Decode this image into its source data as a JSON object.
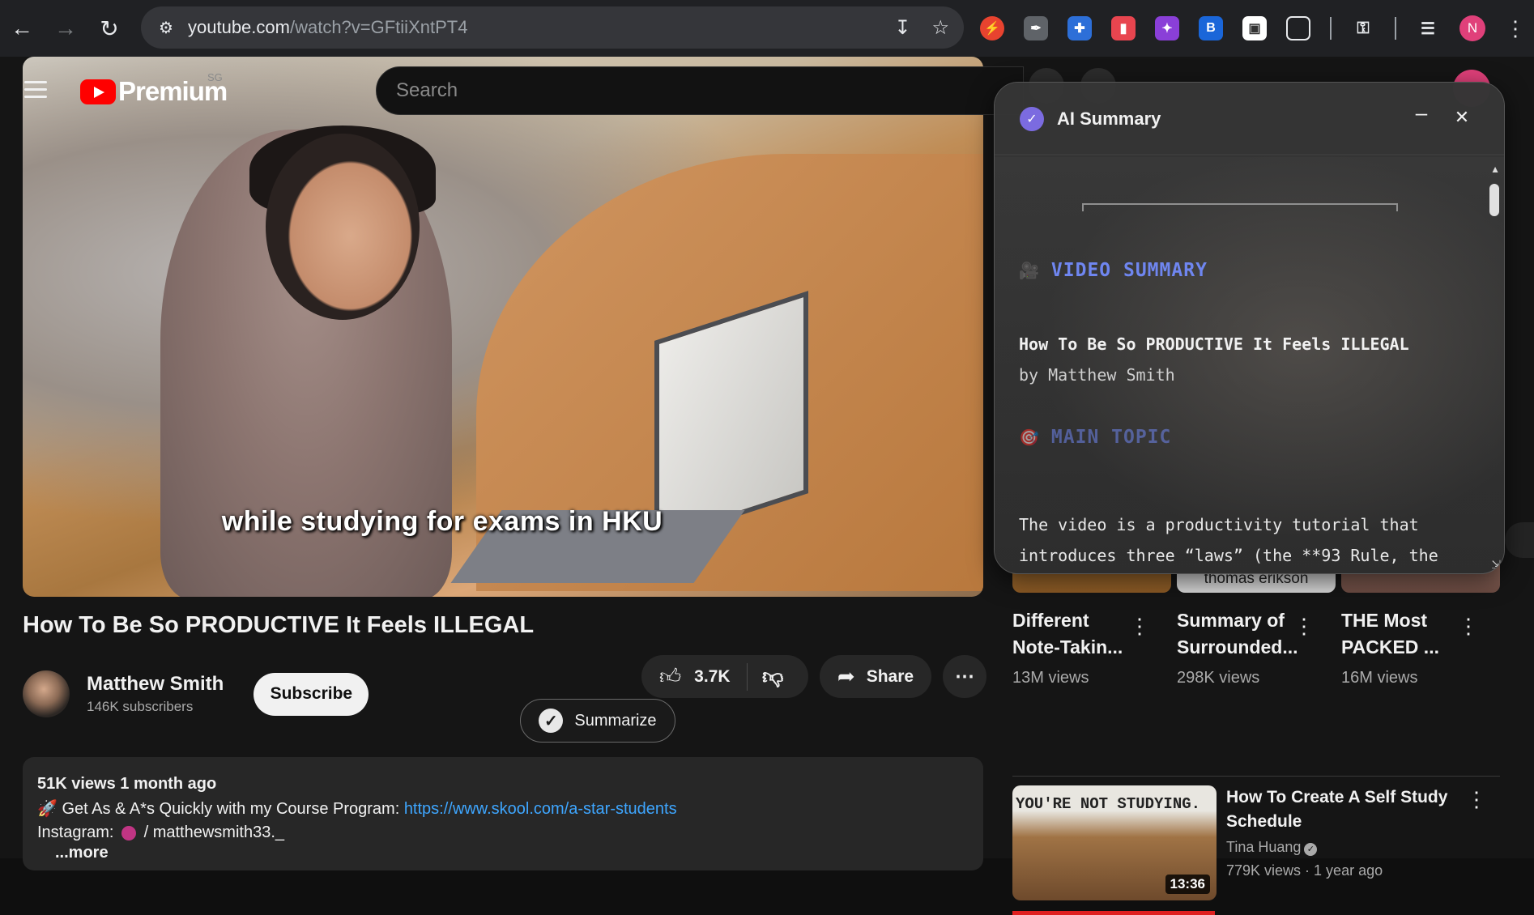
{
  "browser": {
    "url_host": "youtube.com",
    "url_path": "/watch?v=GFtiiXntPT4",
    "profile_initial": "N"
  },
  "youtube": {
    "logo_text": "Premium",
    "country_code": "SG",
    "search_placeholder": "Search"
  },
  "video": {
    "caption": "while studying for exams in HKU",
    "title": "How To Be So PRODUCTIVE It Feels ILLEGAL",
    "channel": "Matthew Smith",
    "subscribers": "146K subscribers",
    "subscribe_label": "Subscribe",
    "likes": "3.7K",
    "share_label": "Share",
    "summarize_label": "Summarize",
    "description": {
      "stats": "51K views  1 month ago",
      "line1_prefix": "🚀 Get As & A*s Quickly with my Course Program: ",
      "line1_link": "https://www.skool.com/a-star-students",
      "line2_prefix": "Instagram: ",
      "line2_handle": " / matthewsmith33._",
      "more": "...more"
    }
  },
  "shorts": [
    {
      "title": "Different Note-Takin...",
      "views": "13M views",
      "thumb_text": ""
    },
    {
      "title": "Summary of Surrounded...",
      "views": "298K views",
      "thumb_text": "thomas erikson"
    },
    {
      "title": "THE Most PACKED ...",
      "views": "16M views",
      "thumb_text": ""
    }
  ],
  "recommendation": {
    "thumb_banner": "YOU'RE NOT STUDYING.",
    "duration": "13:36",
    "title": "How To Create A Self Study Schedule",
    "channel": "Tina Huang",
    "meta": "779K views · 1 year ago"
  },
  "ai_summary": {
    "title": "AI Summary",
    "section_video": "VIDEO SUMMARY",
    "video_title": "How To Be So PRODUCTIVE It Feels ILLEGAL",
    "video_by": "by Matthew Smith",
    "section_topic": "MAIN TOPIC",
    "paragraph": "The video is a productivity tutorial that introduces three “laws” (the **93 Rule, the",
    "emoji_video": "🎥",
    "emoji_topic": "🎯"
  },
  "colors": {
    "accent_blue": "#3ea6ff",
    "yt_red": "#ff0000",
    "ai_heading": "#6f86f0",
    "profile": "#e0407a"
  }
}
